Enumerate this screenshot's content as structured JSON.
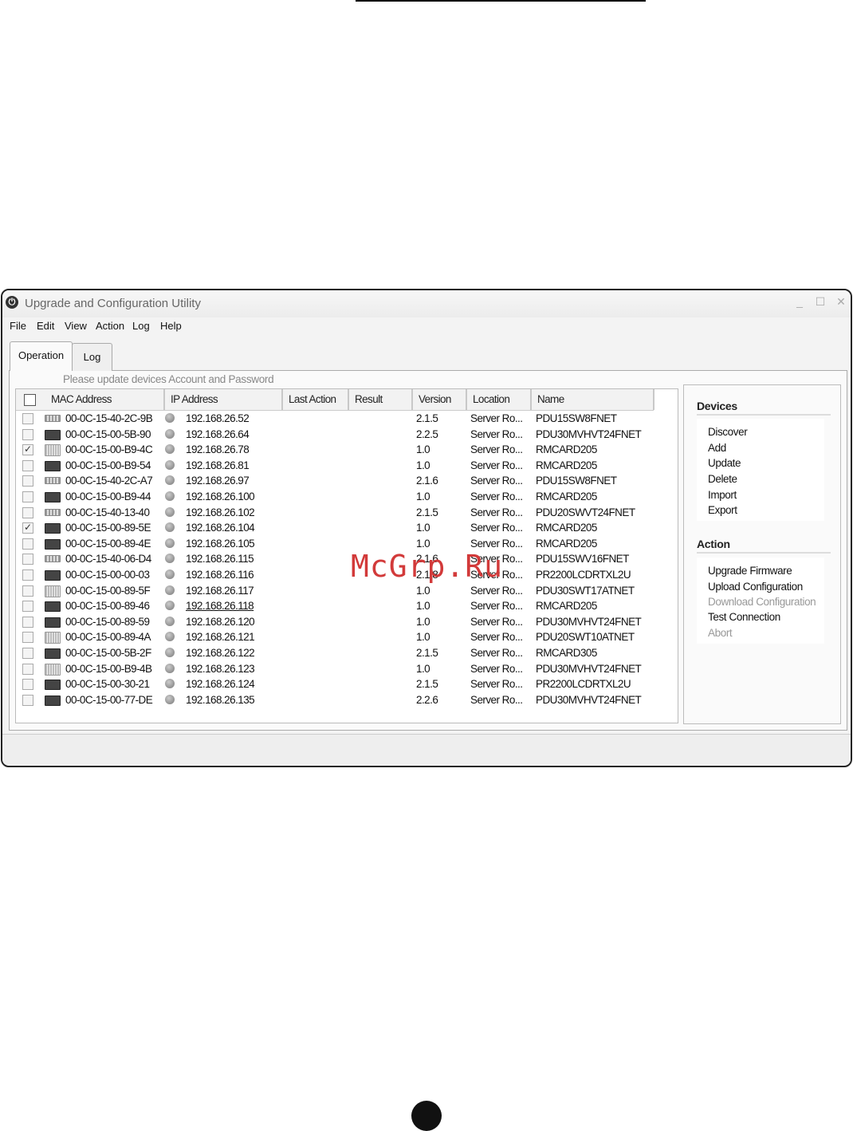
{
  "window": {
    "title": "Upgrade and Configuration Utility",
    "controls": [
      "minimize-icon",
      "maximize-icon",
      "close-icon"
    ]
  },
  "menu": [
    "File",
    "Edit",
    "View",
    "Action",
    "Log",
    "Help"
  ],
  "tabs": [
    "Operation",
    "Log"
  ],
  "notice": "Please update devices Account and Password",
  "table": {
    "columns": [
      "MAC Address",
      "IP Address",
      "Last Action",
      "Result",
      "Version",
      "Location",
      "Name"
    ],
    "rows": [
      {
        "checked": false,
        "icon": "rack",
        "mac": "00-0C-15-40-2C-9B",
        "ip": "192.168.26.52",
        "version": "2.1.5",
        "location": "Server Ro...",
        "name": "PDU15SW8FNET"
      },
      {
        "checked": false,
        "icon": "ups",
        "mac": "00-0C-15-00-5B-90",
        "ip": "192.168.26.64",
        "version": "2.2.5",
        "location": "Server Ro...",
        "name": "PDU30MVHVT24FNET"
      },
      {
        "checked": true,
        "icon": "card",
        "mac": "00-0C-15-00-B9-4C",
        "ip": "192.168.26.78",
        "version": "1.0",
        "location": "Server Ro...",
        "name": "RMCARD205"
      },
      {
        "checked": false,
        "icon": "ups",
        "mac": "00-0C-15-00-B9-54",
        "ip": "192.168.26.81",
        "version": "1.0",
        "location": "Server Ro...",
        "name": "RMCARD205"
      },
      {
        "checked": false,
        "icon": "rack",
        "mac": "00-0C-15-40-2C-A7",
        "ip": "192.168.26.97",
        "version": "2.1.6",
        "location": "Server Ro...",
        "name": "PDU15SW8FNET"
      },
      {
        "checked": false,
        "icon": "ups",
        "mac": "00-0C-15-00-B9-44",
        "ip": "192.168.26.100",
        "version": "1.0",
        "location": "Server Ro...",
        "name": "RMCARD205"
      },
      {
        "checked": false,
        "icon": "rack",
        "mac": "00-0C-15-40-13-40",
        "ip": "192.168.26.102",
        "version": "2.1.5",
        "location": "Server Ro...",
        "name": "PDU20SWVT24FNET"
      },
      {
        "checked": true,
        "icon": "ups",
        "mac": "00-0C-15-00-89-5E",
        "ip": "192.168.26.104",
        "version": "1.0",
        "location": "Server Ro...",
        "name": "RMCARD205"
      },
      {
        "checked": false,
        "icon": "ups",
        "mac": "00-0C-15-00-89-4E",
        "ip": "192.168.26.105",
        "version": "1.0",
        "location": "Server Ro...",
        "name": "RMCARD205"
      },
      {
        "checked": false,
        "icon": "rack",
        "mac": "00-0C-15-40-06-D4",
        "ip": "192.168.26.115",
        "version": "2.1.6",
        "location": "Server Ro...",
        "name": "PDU15SWV16FNET"
      },
      {
        "checked": false,
        "icon": "ups",
        "mac": "00-0C-15-00-00-03",
        "ip": "192.168.26.116",
        "version": "2.1.8",
        "location": "Server Ro...",
        "name": "PR2200LCDRTXL2U"
      },
      {
        "checked": false,
        "icon": "card",
        "mac": "00-0C-15-00-89-5F",
        "ip": "192.168.26.117",
        "version": "1.0",
        "location": "Server Ro...",
        "name": "PDU30SWT17ATNET"
      },
      {
        "checked": false,
        "icon": "ups",
        "mac": "00-0C-15-00-89-46",
        "ip": "192.168.26.118",
        "version": "1.0",
        "location": "Server Ro...",
        "name": "RMCARD205",
        "ip_underlined": true
      },
      {
        "checked": false,
        "icon": "ups",
        "mac": "00-0C-15-00-89-59",
        "ip": "192.168.26.120",
        "version": "1.0",
        "location": "Server Ro...",
        "name": "PDU30MVHVT24FNET"
      },
      {
        "checked": false,
        "icon": "card",
        "mac": "00-0C-15-00-89-4A",
        "ip": "192.168.26.121",
        "version": "1.0",
        "location": "Server Ro...",
        "name": "PDU20SWT10ATNET"
      },
      {
        "checked": false,
        "icon": "ups",
        "mac": "00-0C-15-00-5B-2F",
        "ip": "192.168.26.122",
        "version": "2.1.5",
        "location": "Server Ro...",
        "name": "RMCARD305"
      },
      {
        "checked": false,
        "icon": "card",
        "mac": "00-0C-15-00-B9-4B",
        "ip": "192.168.26.123",
        "version": "1.0",
        "location": "Server Ro...",
        "name": "PDU30MVHVT24FNET"
      },
      {
        "checked": false,
        "icon": "ups",
        "mac": "00-0C-15-00-30-21",
        "ip": "192.168.26.124",
        "version": "2.1.5",
        "location": "Server Ro...",
        "name": "PR2200LCDRTXL2U"
      },
      {
        "checked": false,
        "icon": "ups",
        "mac": "00-0C-15-00-77-DE",
        "ip": "192.168.26.135",
        "version": "2.2.6",
        "location": "Server Ro...",
        "name": "PDU30MVHVT24FNET"
      }
    ]
  },
  "sidebar": {
    "devices_title": "Devices",
    "devices": [
      "Discover",
      "Add",
      "Update",
      "Delete",
      "Import",
      "Export"
    ],
    "action_title": "Action",
    "actions": [
      {
        "label": "Upgrade Firmware",
        "enabled": true
      },
      {
        "label": "Upload Configuration",
        "enabled": true
      },
      {
        "label": "Download Configuration",
        "enabled": false
      },
      {
        "label": "Test Connection",
        "enabled": true
      },
      {
        "label": "Abort",
        "enabled": false
      }
    ]
  },
  "watermark": "McGrp.Ru"
}
